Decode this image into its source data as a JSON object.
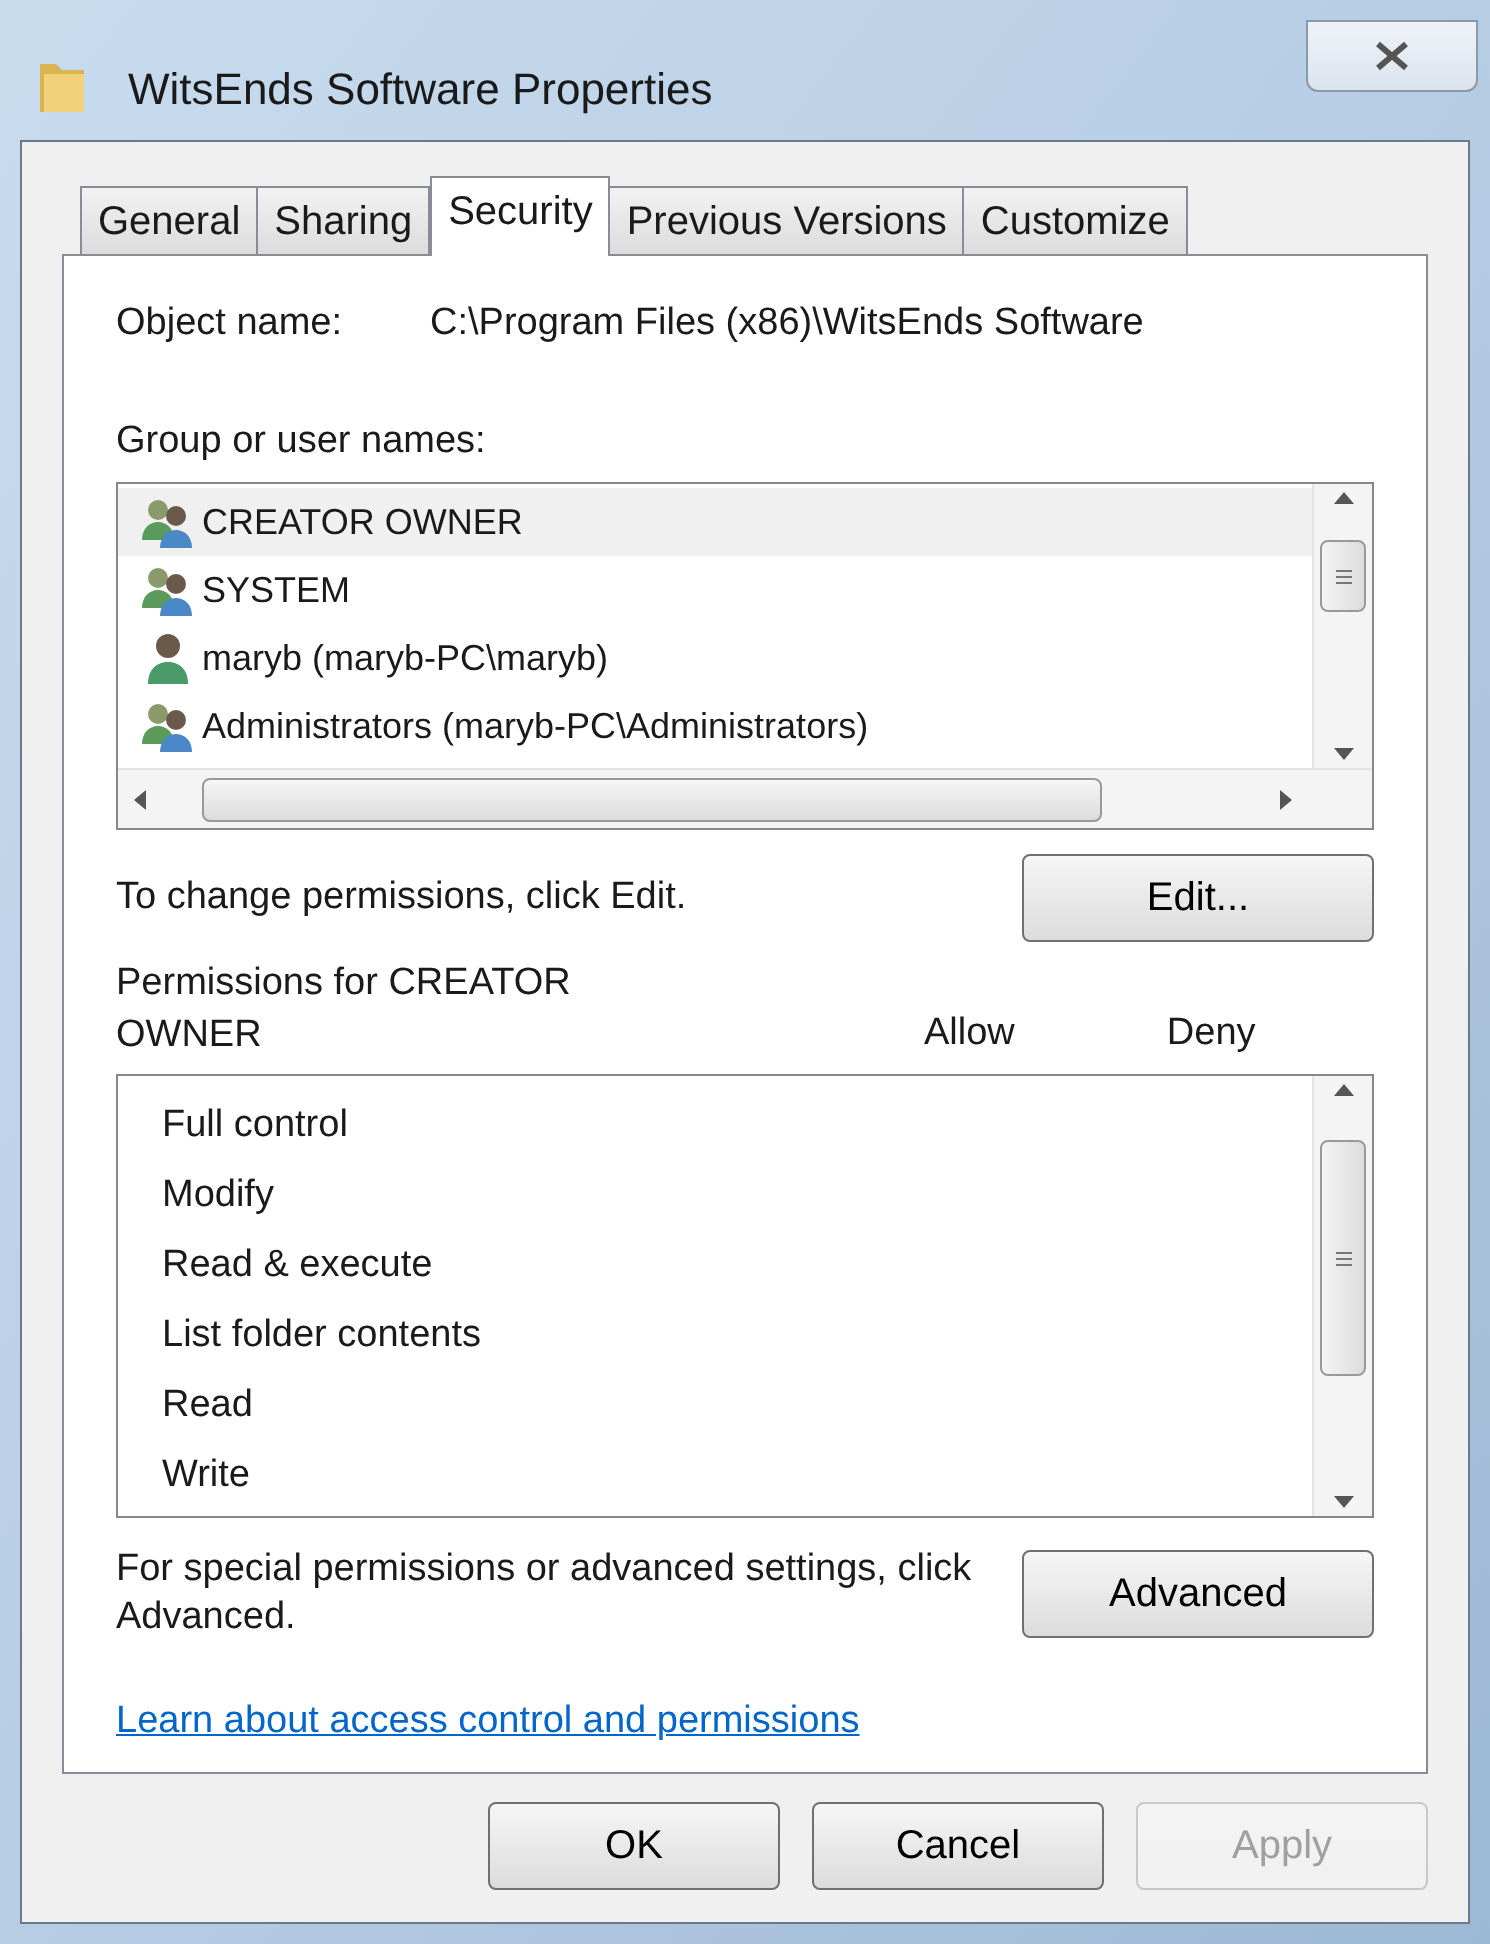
{
  "window": {
    "title": "WitsEnds Software Properties"
  },
  "tabs": [
    {
      "label": "General",
      "selected": false
    },
    {
      "label": "Sharing",
      "selected": false
    },
    {
      "label": "Security",
      "selected": true
    },
    {
      "label": "Previous Versions",
      "selected": false
    },
    {
      "label": "Customize",
      "selected": false
    }
  ],
  "object_name": {
    "label": "Object name:",
    "value": "C:\\Program Files (x86)\\WitsEnds Software"
  },
  "group_list": {
    "label": "Group or user names:",
    "items": [
      {
        "name": "CREATOR OWNER",
        "kind": "group",
        "selected": true
      },
      {
        "name": "SYSTEM",
        "kind": "group",
        "selected": false
      },
      {
        "name": "maryb (maryb-PC\\maryb)",
        "kind": "user",
        "selected": false
      },
      {
        "name": "Administrators (maryb-PC\\Administrators)",
        "kind": "group",
        "selected": false
      }
    ]
  },
  "change_hint": "To change permissions, click Edit.",
  "edit_button": "Edit...",
  "permissions": {
    "title_line1": "Permissions for CREATOR",
    "title_line2": "OWNER",
    "allow_header": "Allow",
    "deny_header": "Deny",
    "items": [
      "Full control",
      "Modify",
      "Read & execute",
      "List folder contents",
      "Read",
      "Write"
    ]
  },
  "advanced_hint": "For special permissions or advanced settings, click Advanced.",
  "advanced_button": "Advanced",
  "link": "Learn about access control and permissions",
  "buttons": [
    {
      "label": "OK",
      "disabled": false
    },
    {
      "label": "Cancel",
      "disabled": false
    },
    {
      "label": "Apply",
      "disabled": true
    }
  ]
}
